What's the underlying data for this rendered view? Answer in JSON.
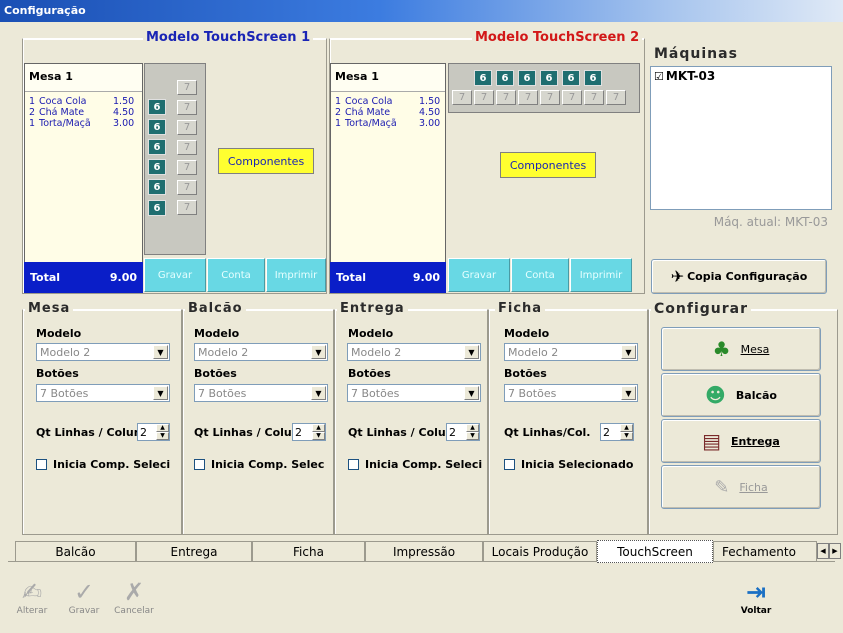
{
  "window": {
    "title": "Configuração"
  },
  "ts1": {
    "legend": "Modelo  TouchScreen 1",
    "mesa_title": "Mesa 1",
    "items": [
      {
        "qty": "1",
        "name": "Coca Cola",
        "price": "1.50"
      },
      {
        "qty": "2",
        "name": "Chá Mate",
        "price": "4.50"
      },
      {
        "qty": "1",
        "name": "Torta/Maçã",
        "price": "3.00"
      }
    ],
    "total_label": "Total",
    "total_value": "9.00",
    "key_a": "6",
    "key_b": "7",
    "componentes": "Componentes",
    "gravar": "Gravar",
    "conta": "Conta",
    "imprimir": "Imprimir"
  },
  "ts2": {
    "legend": "Modelo  TouchScreen 2",
    "mesa_title": "Mesa 1",
    "items": [
      {
        "qty": "1",
        "name": "Coca Cola",
        "price": "1.50"
      },
      {
        "qty": "2",
        "name": "Chá Mate",
        "price": "4.50"
      },
      {
        "qty": "1",
        "name": "Torta/Maçã",
        "price": "3.00"
      }
    ],
    "total_label": "Total",
    "total_value": "9.00",
    "key_a": "6",
    "key_b": "7",
    "componentes": "Componentes",
    "gravar": "Gravar",
    "conta": "Conta",
    "imprimir": "Imprimir"
  },
  "maquinas": {
    "legend": "Máquinas",
    "item": "MKT-03",
    "current": "Máq. atual: MKT-03",
    "copy_button": "Copia Configuração"
  },
  "sections": [
    {
      "title": "Mesa",
      "modelo_label": "Modelo",
      "modelo_value": "Modelo 2",
      "botoes_label": "Botões",
      "botoes_value": "7 Botões",
      "lines_label": "Qt Linhas / Colun",
      "lines_value": "2",
      "check_label": "Inicia  Comp. Seleci"
    },
    {
      "title": "Balcão",
      "modelo_label": "Modelo",
      "modelo_value": "Modelo 2",
      "botoes_label": "Botões",
      "botoes_value": "7 Botões",
      "lines_label": "Qt Linhas / Colun",
      "lines_value": "2",
      "check_label": "Inicia  Comp. Selec"
    },
    {
      "title": "Entrega",
      "modelo_label": "Modelo",
      "modelo_value": "Modelo 2",
      "botoes_label": "Botões",
      "botoes_value": "7 Botões",
      "lines_label": "Qt Linhas / Colu",
      "lines_value": "2",
      "check_label": "Inicia  Comp. Seleci"
    },
    {
      "title": "Ficha",
      "modelo_label": "Modelo",
      "modelo_value": "Modelo 2",
      "botoes_label": "Botões",
      "botoes_value": "7 Botões",
      "lines_label": "Qt Linhas/Col.",
      "lines_value": "2",
      "check_label": "Inicia Selecionado"
    }
  ],
  "configurar": {
    "legend": "Configurar",
    "mesa": "Mesa",
    "balcao": "Balcão",
    "entrega": "Entrega",
    "ficha": "Ficha"
  },
  "tabs": [
    "Balcão",
    "Entrega",
    "Ficha",
    "Impressão",
    "Locais Produção",
    "TouchScreen",
    "Fechamento"
  ],
  "toolbar": {
    "alterar": "Alterar",
    "gravar": "Gravar",
    "cancelar": "Cancelar",
    "voltar": "Voltar"
  },
  "colors": {
    "accent_blue": "#1a25b5",
    "accent_red": "#d21818",
    "total_bar": "#0a1ec8",
    "key_teal": "#1f6e70",
    "yellow_button": "#ffff30",
    "cyan_button": "#68d8e4"
  }
}
